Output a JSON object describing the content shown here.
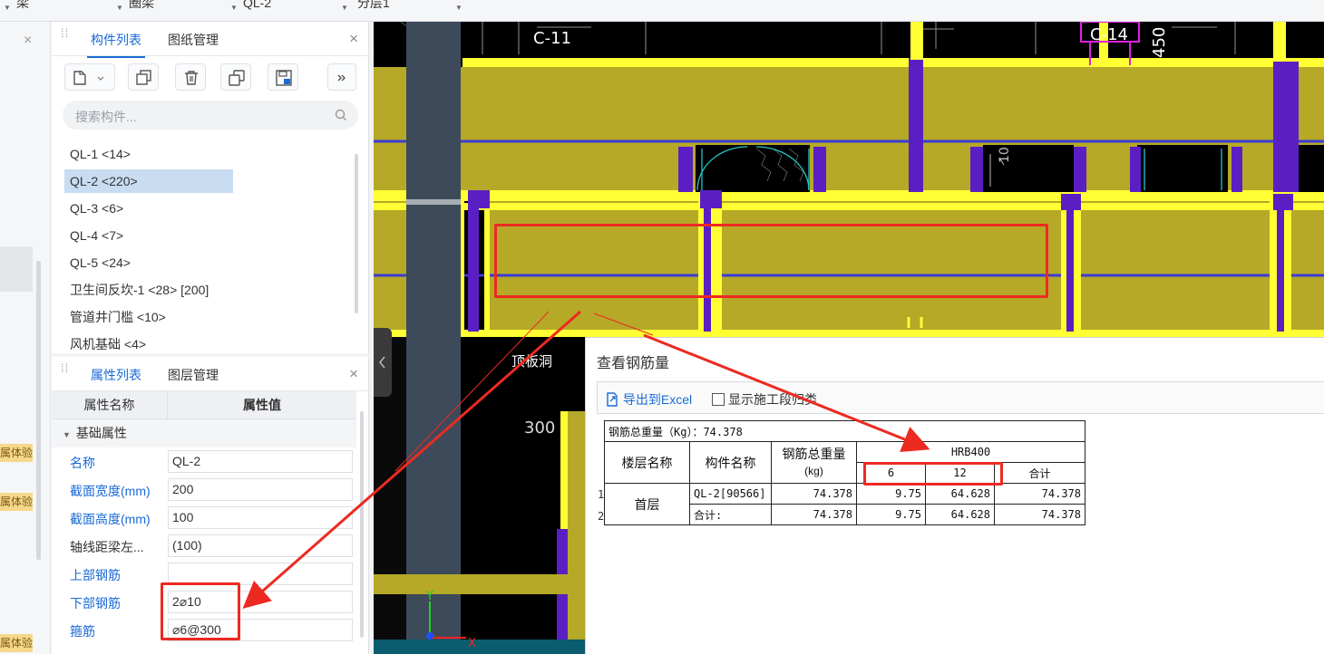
{
  "topbar": {
    "dropdowns": [
      "梁",
      "圈梁",
      "QL-2",
      "分层1"
    ]
  },
  "left_strip": {
    "close": "×",
    "badges": [
      "属体验",
      "属体验",
      "属体验"
    ]
  },
  "components_panel": {
    "tabs": [
      "构件列表",
      "图纸管理"
    ],
    "close": "×",
    "toolbar": [
      "new-component",
      "copy",
      "delete",
      "layer-copy",
      "save-template",
      "more"
    ],
    "search_placeholder": "搜索构件...",
    "items": [
      "QL-1 <14>",
      "QL-2 <220>",
      "QL-3 <6>",
      "QL-4 <7>",
      "QL-5 <24>",
      "卫生间反坎-1 <28> [200]",
      "管道井门槛 <10>",
      "风机基础 <4>"
    ],
    "selected_index": 1
  },
  "properties_panel": {
    "tabs": [
      "属性列表",
      "图层管理"
    ],
    "close": "×",
    "header": [
      "属性名称",
      "属性值"
    ],
    "group": "基础属性",
    "rows": [
      {
        "name": "名称",
        "value": "QL-2"
      },
      {
        "name": "截面宽度(mm)",
        "value": "200"
      },
      {
        "name": "截面高度(mm)",
        "value": "100"
      },
      {
        "name": "轴线距梁左...",
        "value": "(100)"
      },
      {
        "name": "上部钢筋",
        "value": ""
      },
      {
        "name": "下部钢筋",
        "value": "2⌀10"
      },
      {
        "name": "箍筋",
        "value": "⌀6@300"
      }
    ]
  },
  "cad": {
    "labels": [
      "C-11",
      "C-14",
      "450",
      "顶板洞",
      "300",
      "10"
    ],
    "axis_y": "Y",
    "axis_x": "X"
  },
  "dialog": {
    "title": "查看钢筋量",
    "export_label": "导出到Excel",
    "checkbox_label": "显示施工段归类",
    "table": {
      "total": "钢筋总重量（Kg）：74.378",
      "headers": {
        "floor": "楼层名称",
        "component": "构件名称",
        "total_weight": "钢筋总重量",
        "unit": "(kg)",
        "grade": "HRB400",
        "d6": "6",
        "d12": "12",
        "subtotal": "合计"
      },
      "row_indices": [
        "1",
        "2"
      ],
      "floor": "首层",
      "rows": [
        {
          "component": "QL-2[90566]",
          "total": "74.378",
          "d6": "9.75",
          "d12": "64.628",
          "subtotal": "74.378"
        },
        {
          "component": "合计:",
          "total": "74.378",
          "d6": "9.75",
          "d12": "64.628",
          "subtotal": "74.378"
        }
      ]
    }
  },
  "colors": {
    "wall": "#b5a927",
    "beam": "#ffff33",
    "column": "#5a1fc2",
    "accent": "#1a6ad6",
    "highlight": "#ec2a22"
  }
}
